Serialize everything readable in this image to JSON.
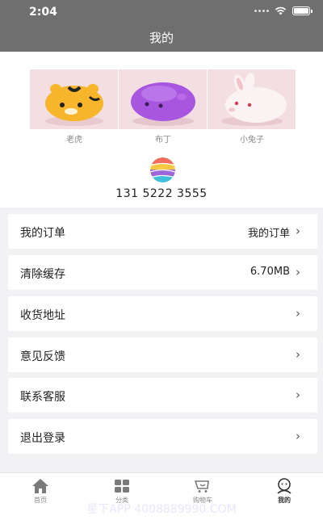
{
  "status": {
    "time": "2:04"
  },
  "nav": {
    "title": "我的"
  },
  "products": [
    {
      "name": "老虎"
    },
    {
      "name": "布丁"
    },
    {
      "name": "小兔子"
    }
  ],
  "profile": {
    "phone": "131 5222 3555"
  },
  "menu": [
    {
      "label": "我的订单",
      "value": "我的订单"
    },
    {
      "label": "清除缓存",
      "value": "6.70MB"
    },
    {
      "label": "收货地址",
      "value": ""
    },
    {
      "label": "意见反馈",
      "value": ""
    },
    {
      "label": "联系客服",
      "value": ""
    },
    {
      "label": "退出登录",
      "value": ""
    }
  ],
  "tabs": [
    {
      "label": "首页",
      "icon": "home-icon"
    },
    {
      "label": "分类",
      "icon": "category-icon"
    },
    {
      "label": "购物车",
      "icon": "cart-icon"
    },
    {
      "label": "我的",
      "icon": "profile-icon"
    }
  ],
  "watermark": "星下APP 4008889990.COM",
  "colors": {
    "bar": "#6f6f6f",
    "page_bg": "#f2f2f4",
    "card": "#ffffff"
  }
}
